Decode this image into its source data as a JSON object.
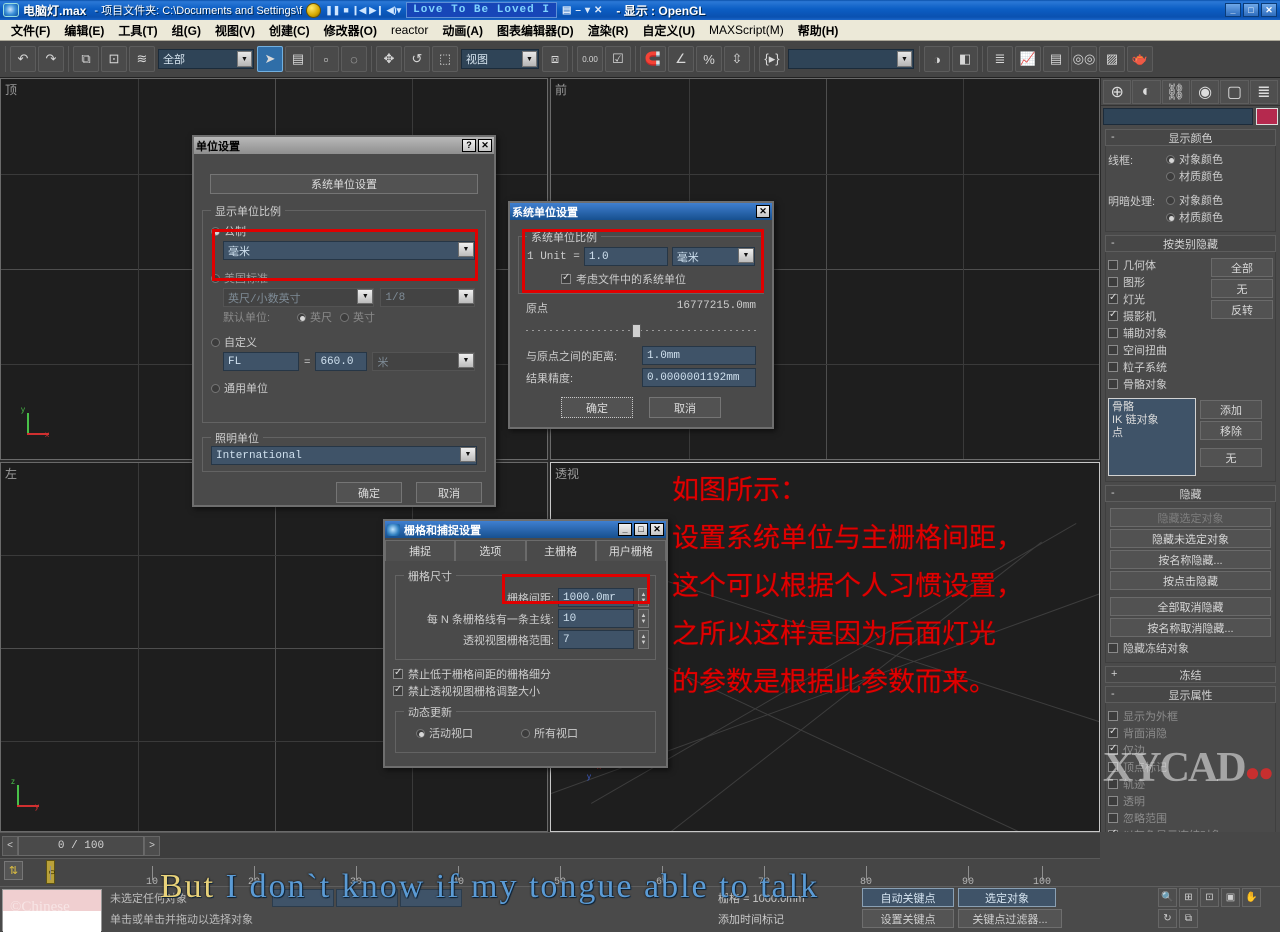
{
  "titlebar": {
    "app_title": "电脑灯.max",
    "path": "- 项目文件夹: C:\\Documents and Settings\\f",
    "player_title": "Love To Be Loved I",
    "display_mode": "- 显示 : OpenGL",
    "min": "_",
    "max": "□",
    "close": "✕",
    "pl_min": "–",
    "pl_menu": "▾",
    "pl_close": "✕"
  },
  "menu": {
    "items": [
      {
        "label": "文件(F)"
      },
      {
        "label": "编辑(E)"
      },
      {
        "label": "工具(T)"
      },
      {
        "label": "组(G)"
      },
      {
        "label": "视图(V)"
      },
      {
        "label": "创建(C)"
      },
      {
        "label": "修改器(O)"
      },
      {
        "label": "reactor",
        "latin": true
      },
      {
        "label": "动画(A)"
      },
      {
        "label": "图表编辑器(D)"
      },
      {
        "label": "渲染(R)"
      },
      {
        "label": "自定义(U)"
      },
      {
        "label": "MAXScript(M)",
        "latin": true
      },
      {
        "label": "帮助(H)"
      }
    ]
  },
  "toolbar": {
    "selection_filter": "全部",
    "coord_system": "视图",
    "named_selection": "",
    "spinner_value": "0.00"
  },
  "viewports": [
    {
      "label": "顶"
    },
    {
      "label": "前"
    },
    {
      "label": "左"
    },
    {
      "label": "透视"
    }
  ],
  "annotation": {
    "lines": [
      "如图所示：",
      "设置系统单位与主栅格间距，",
      "这个可以根据个人习惯设置，",
      "之所以这样是因为后面灯光",
      "的参数是根据此参数而来。"
    ],
    "color": "#e00000"
  },
  "units_dialog": {
    "title": "单位设置",
    "help_btn": "?",
    "close_btn": "✕",
    "system_unit_setup_btn": "系统单位设置",
    "display_scale_group": "显示单位比例",
    "metric_label": "公制",
    "metric_value": "毫米",
    "us_label": "美国标准",
    "us_value": "英尺/小数英寸",
    "us_fraction": "1/8",
    "default_unit_label": "默认单位:",
    "default_feet": "英尺",
    "default_inch": "英寸",
    "custom_label": "自定义",
    "custom_name": "FL",
    "custom_equals": "=",
    "custom_value": "660.0",
    "custom_unit": "米",
    "generic_label": "通用单位",
    "lighting_group": "照明单位",
    "lighting_value": "International",
    "ok": "确定",
    "cancel": "取消"
  },
  "system_units_dialog": {
    "title": "系统单位设置",
    "close_btn": "✕",
    "scale_group": "系统单位比例",
    "unit_prefix": "1 Unit =",
    "unit_value": "1.0",
    "unit_name": "毫米",
    "respect_files_label": "考虑文件中的系统单位",
    "origin_label": "原点",
    "origin_value": "16777215.0mm",
    "distance_label": "与原点之间的距离:",
    "distance_value": "1.0mm",
    "accuracy_label": "结果精度:",
    "accuracy_value": "0.0000001192mm",
    "ok": "确定",
    "cancel": "取消"
  },
  "grid_dialog": {
    "title": "栅格和捕捉设置",
    "min_btn": "_",
    "max_btn": "□",
    "close_btn": "✕",
    "tabs": [
      "捕捉",
      "选项",
      "主栅格",
      "用户栅格"
    ],
    "selected_tab": "主栅格",
    "size_group": "栅格尺寸",
    "grid_spacing_label": "栅格间距:",
    "grid_spacing_value": "1000.0mr",
    "major_lines_label": "每 N 条栅格线有一条主线:",
    "major_lines_value": "10",
    "persp_range_label": "透视视图栅格范围:",
    "persp_range_value": "7",
    "inhibit_subdiv": "禁止低于栅格间距的栅格细分",
    "inhibit_persp": "禁止透视视图栅格调整大小",
    "dynamic_group": "动态更新",
    "active_vp": "活动视口",
    "all_vp": "所有视口"
  },
  "command_panel": {
    "tabs": [
      "create-tab",
      "modify-tab",
      "hierarchy-tab",
      "motion-tab",
      "display-tab",
      "utilities-tab"
    ],
    "object_name": "",
    "rollouts": [
      {
        "id": "display_color",
        "title": "显示颜色",
        "expander": "-",
        "wireframe_label": "线框:",
        "wireframe_options": [
          "对象颜色",
          "材质颜色"
        ],
        "wireframe_selected": 0,
        "shaded_label": "明暗处理:",
        "shaded_options": [
          "对象颜色",
          "材质颜色"
        ],
        "shaded_selected": 1
      },
      {
        "id": "hide_by_category",
        "title": "按类别隐藏",
        "expander": "-",
        "categories": [
          {
            "label": "几何体",
            "checked": false
          },
          {
            "label": "图形",
            "checked": false
          },
          {
            "label": "灯光",
            "checked": true
          },
          {
            "label": "摄影机",
            "checked": true
          },
          {
            "label": "辅助对象",
            "checked": false
          },
          {
            "label": "空间扭曲",
            "checked": false
          },
          {
            "label": "粒子系统",
            "checked": false
          },
          {
            "label": "骨骼对象",
            "checked": false
          }
        ],
        "buttons": [
          "全部",
          "无",
          "反转"
        ],
        "list_items": [
          "骨骼",
          "IK 链对象",
          "点"
        ],
        "add_btn": "添加",
        "remove_btn": "移除",
        "none_btn": "无"
      },
      {
        "id": "hide",
        "title": "隐藏",
        "expander": "-",
        "buttons": [
          {
            "label": "隐藏选定对象",
            "dim": true
          },
          {
            "label": "隐藏未选定对象",
            "dim": false
          },
          {
            "label": "按名称隐藏...",
            "dim": false
          },
          {
            "label": "按点击隐藏",
            "dim": false
          },
          {
            "label": "全部取消隐藏",
            "dim": false
          },
          {
            "label": "按名称取消隐藏...",
            "dim": false
          }
        ],
        "hide_frozen_label": "隐藏冻结对象",
        "hide_frozen_checked": false
      },
      {
        "id": "freeze",
        "title": "冻结",
        "expander": "+"
      },
      {
        "id": "display_properties",
        "title": "显示属性",
        "expander": "-",
        "items": [
          {
            "label": "显示为外框",
            "checked": false
          },
          {
            "label": "背面消隐",
            "checked": true
          },
          {
            "label": "仅边",
            "checked": true
          },
          {
            "label": "顶点标记",
            "checked": false
          },
          {
            "label": "轨迹",
            "checked": false
          },
          {
            "label": "透明",
            "checked": false
          },
          {
            "label": "忽略范围",
            "checked": false
          },
          {
            "label": "以灰色显示冻结对象",
            "checked": true
          }
        ]
      }
    ]
  },
  "bottom": {
    "frame_indicator": "0 / 100",
    "prev_arrow": "<",
    "next_arrow": ">",
    "ruler_labels": [
      "10",
      "20",
      "30",
      "40",
      "50",
      "60",
      "70",
      "80",
      "90",
      "100"
    ],
    "status_line1": "未选定任何对象",
    "status_line2": "单击或单击并拖动以选择对象",
    "coord_x": "",
    "coord_y": "",
    "coord_z": "",
    "grid_text": "栅格 = 1000.0mm",
    "time_tag": "添加时间标记",
    "auto_key": "自动关键点",
    "set_key": "设置关键点",
    "selected_obj": "选定对象",
    "key_filters": "关键点过滤器...",
    "spinner": "0",
    "watermark": "XYCAD",
    "watermark_suffix": ".com",
    "overlay_text_amber": "But",
    "overlay_text_blue": "I don`t know if my tongue able to talk"
  }
}
